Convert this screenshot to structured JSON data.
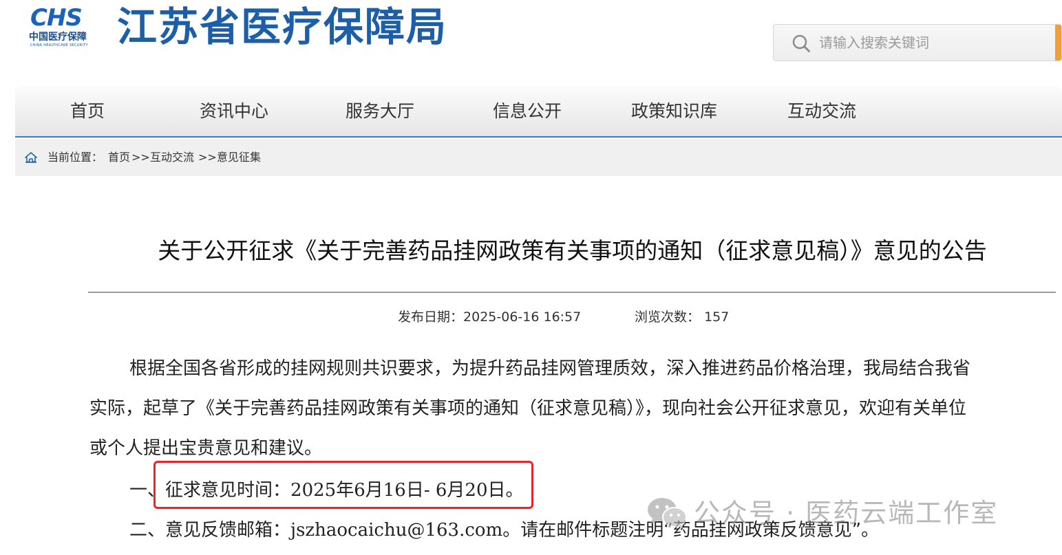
{
  "header": {
    "logo_mark": "CHS",
    "logo_cn": "中国医疗保障",
    "logo_en": "CHINA HEALTHCARE SECURITY",
    "site_title": "江苏省医疗保障局"
  },
  "search": {
    "placeholder": "请输入搜索关键词",
    "icon": "search-icon",
    "accent_color": "#f0a03a"
  },
  "nav": {
    "items": [
      {
        "label": "首页"
      },
      {
        "label": "资讯中心"
      },
      {
        "label": "服务大厅"
      },
      {
        "label": "信息公开"
      },
      {
        "label": "政策知识库"
      },
      {
        "label": "互动交流"
      }
    ]
  },
  "breadcrumb": {
    "label": "当前位置：",
    "items": [
      "首页",
      "互动交流",
      "意见征集"
    ],
    "separator": ">>",
    "icon": "home-icon"
  },
  "article": {
    "title": "关于公开征求《关于完善药品挂网政策有关事项的通知（征求意见稿）》意见的公告",
    "publish_label": "发布日期：",
    "publish_date": "2025-06-16 16:57",
    "views_label": "浏览次数：",
    "views": "157",
    "para1_lines": [
      "根据全国各省形成的挂网规则共识要求，为提升药品挂网管理质效，深入推进药品价格治理，我局结合我省",
      "实际，起草了《关于完善药品挂网政策有关事项的通知（征求意见稿）》，现向社会公开征求意见，欢迎有关单位",
      "或个人提出宝贵意见和建议。"
    ],
    "item1_prefix": "一、",
    "item1_label": "征求意见时间：",
    "item1_value": "2025年6月16日- 6月20日。",
    "item2_prefix": "二、",
    "item2_label": "意见反馈邮箱：",
    "item2_email": "jszhaocaichu@163.com",
    "item2_rest": "。请在邮件标题注明“药品挂网政策反馈意见”。"
  },
  "watermark": {
    "text": "公众号 · 医药云端工作室",
    "icon": "wechat-icon"
  },
  "colors": {
    "brand_blue": "#1d5ea9",
    "nav_underline": "#3d7cc4",
    "highlight_red": "#e8262a"
  }
}
